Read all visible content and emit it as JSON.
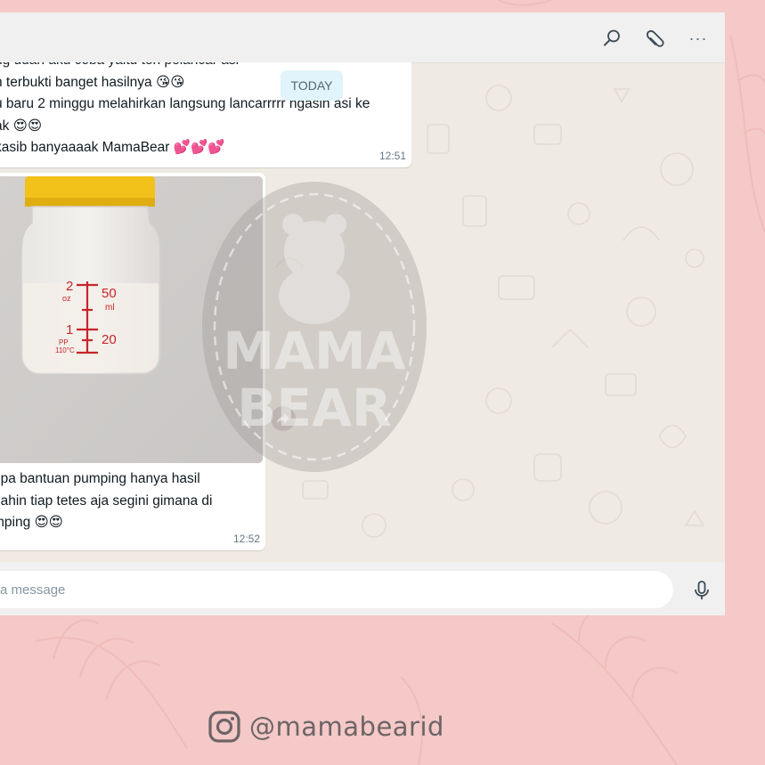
{
  "window": {
    "toolbar": {
      "search_icon": "search-icon",
      "attach_icon": "paperclip-icon",
      "menu_icon": "more-options-icon",
      "menu_glyph": "···"
    },
    "date_separator": "TODAY",
    "messages": [
      {
        "lines": [
          "ng udah aku coba yaitu teh pelancar asi",
          "n terbukti banget hasilnya 😘😘",
          "u baru 2 minggu melahirkan langsung lancarrrrr ngasih asi ke",
          "ak 😍😍",
          "kasib banyaaaak MamaBear 💕💕💕"
        ],
        "time": "12:51"
      },
      {
        "photo": {
          "bottle_oz_top": "2",
          "bottle_oz_unit": "oz",
          "bottle_oz_bottom": "1",
          "bottle_ml_top": "50",
          "bottle_ml_unit": "ml",
          "bottle_ml_bottom": "20",
          "bottle_material": "PP",
          "bottle_temp": "110°C"
        },
        "lines": [
          "npa bantuan pumping hanya hasil",
          "dahin tiap tetes aja segini gimana di",
          "mping 😍😍"
        ],
        "time": "12:52"
      }
    ],
    "watermark": {
      "line1": "MAMA",
      "line2": "BEAR"
    },
    "composer": {
      "placeholder": "a message",
      "mic_icon": "microphone-icon"
    }
  },
  "instagram": {
    "icon": "instagram-icon",
    "handle": "@mamabearid"
  }
}
